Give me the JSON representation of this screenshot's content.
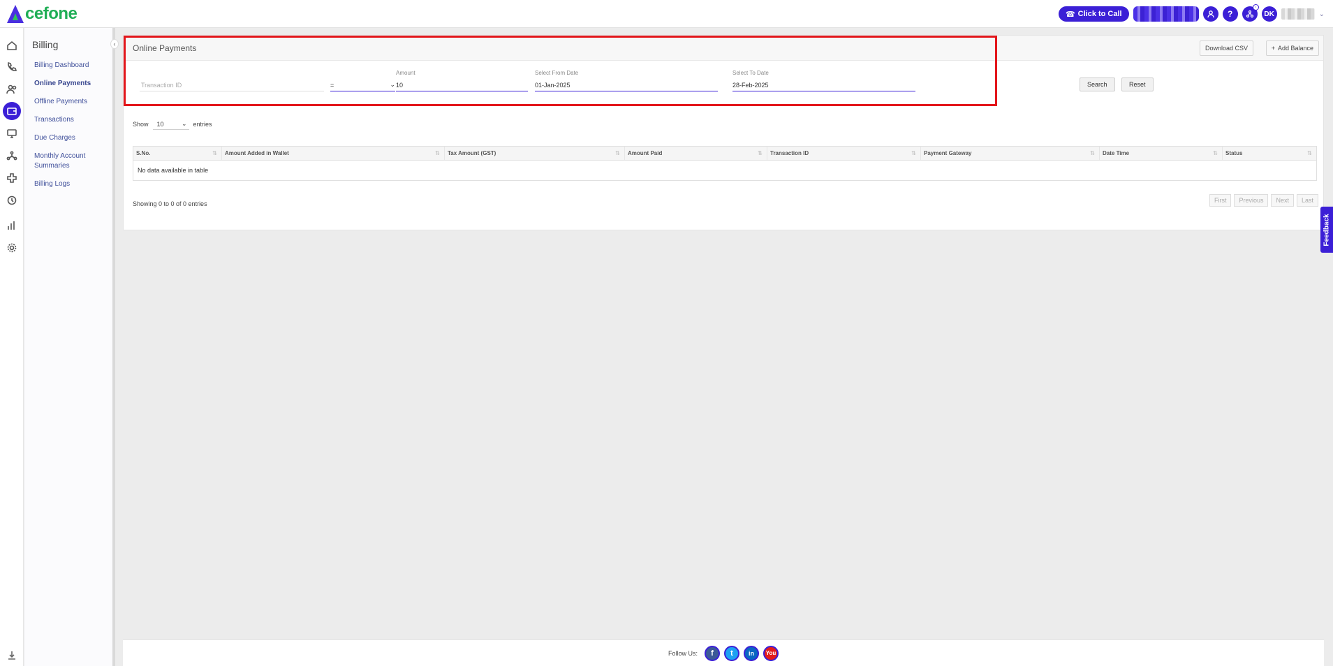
{
  "brand": {
    "logo_text": "cefone",
    "logo_mark": "A"
  },
  "topbar": {
    "click_to_call": "Click to Call",
    "help_label": "?",
    "avatar_initials": "DK"
  },
  "sidenav": {
    "title": "Billing",
    "items": [
      {
        "label": "Billing Dashboard"
      },
      {
        "label": "Online Payments"
      },
      {
        "label": "Offline Payments"
      },
      {
        "label": "Transactions"
      },
      {
        "label": "Due Charges"
      },
      {
        "label": "Monthly Account Summaries"
      },
      {
        "label": "Billing Logs"
      }
    ]
  },
  "panel": {
    "title": "Online Payments",
    "download_csv": "Download CSV",
    "add_balance": "Add Balance",
    "add_balance_icon": "+"
  },
  "filters": {
    "transaction_id_placeholder": "Transaction ID",
    "operator_value": "=",
    "amount_label": "Amount",
    "amount_value": "10",
    "from_label": "Select From Date",
    "from_value": "01-Jan-2025",
    "to_label": "Select To Date",
    "to_value": "28-Feb-2025",
    "search": "Search",
    "reset": "Reset"
  },
  "table": {
    "show_label": "Show",
    "entries_value": "10",
    "entries_label": "entries",
    "columns": [
      "S.No.",
      "Amount Added in Wallet",
      "Tax Amount (GST)",
      "Amount Paid",
      "Transaction ID",
      "Payment Gateway",
      "Date Time",
      "Status"
    ],
    "empty_message": "No data available in table",
    "info": "Showing 0 to 0 of 0 entries",
    "pager": {
      "first": "First",
      "previous": "Previous",
      "next": "Next",
      "last": "Last"
    }
  },
  "feedback": "Feedback",
  "footer": {
    "follow_us": "Follow Us:",
    "facebook": "f",
    "twitter": "t",
    "linkedin": "in",
    "youtube": "You"
  },
  "colors": {
    "accent": "#3b1fd6",
    "brand_green": "#1fae55",
    "highlight": "#e3161b"
  }
}
